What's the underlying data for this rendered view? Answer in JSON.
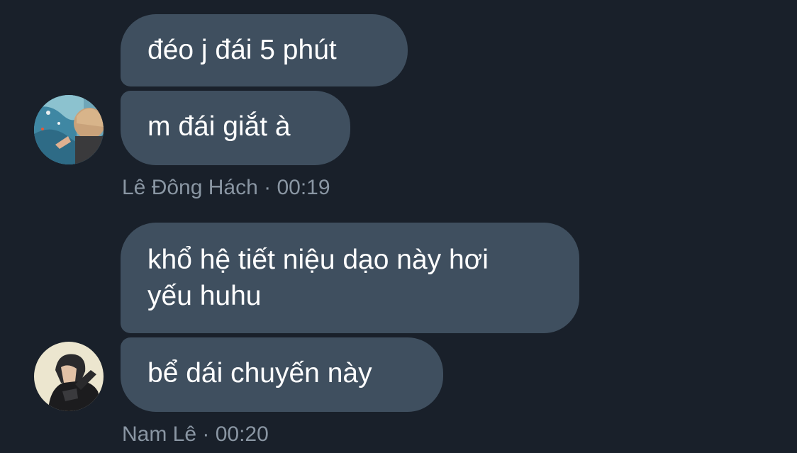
{
  "colors": {
    "background": "#19202a",
    "bubble": "#3f4f5f",
    "bubble_text": "#ffffff",
    "meta_text": "#8a96a3"
  },
  "groups": [
    {
      "sender": "Lê Đông Hách",
      "time": "00:19",
      "separator": " · ",
      "avatar": "user-avatar-lake-photo",
      "messages": [
        "đéo j đái 5 phút",
        "m đái giắt à"
      ]
    },
    {
      "sender": "Nam Lê",
      "time": "00:20",
      "separator": " · ",
      "avatar": "user-avatar-portrait-photo",
      "messages": [
        "khổ hệ tiết niệu dạo này hơi\nyếu huhu",
        "bể dái chuyến này"
      ]
    }
  ]
}
